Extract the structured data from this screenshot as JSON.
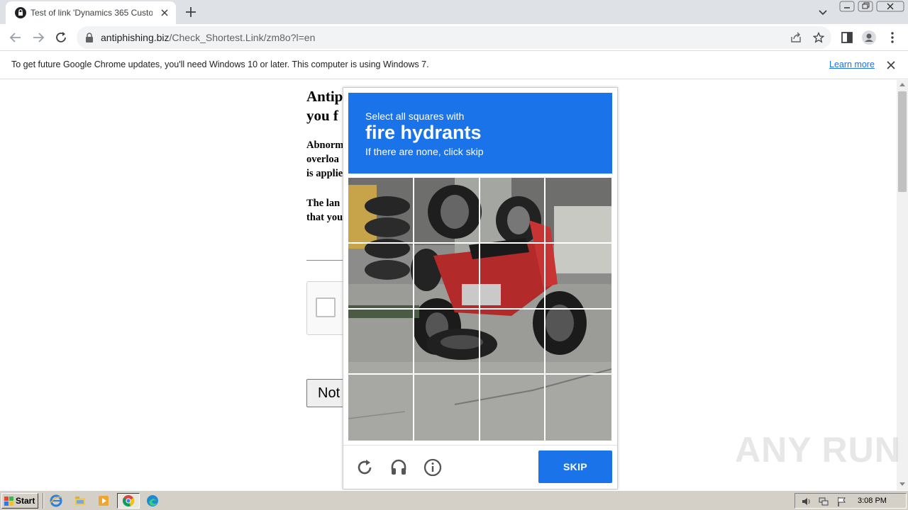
{
  "browser": {
    "tab": {
      "title": "Test of link 'Dynamics 365 Customer"
    },
    "url": {
      "host": "antiphishing.biz",
      "path": "/Check_Shortest.Link/zm8o?l=en"
    },
    "infobar": {
      "message": "To get future Google Chrome updates, you'll need Windows 10 or later. This computer is using Windows 7.",
      "link": "Learn more"
    }
  },
  "page": {
    "title_line1": "Antip",
    "title_line2": "you f",
    "para1": [
      "Abnorm",
      "overloa",
      "is applie"
    ],
    "para2": [
      "The lan",
      "that you"
    ],
    "button_label": "Not"
  },
  "captcha": {
    "instruction": "Select all squares with",
    "target": "fire hydrants",
    "hint": "If there are none, click skip",
    "grid": "4x4",
    "skip_label": "SKIP",
    "colors": {
      "header": "#1a73e8",
      "skip": "#1a73e8"
    }
  },
  "watermark": "ANY RUN",
  "taskbar": {
    "start_label": "Start",
    "clock": "3:08 PM"
  }
}
